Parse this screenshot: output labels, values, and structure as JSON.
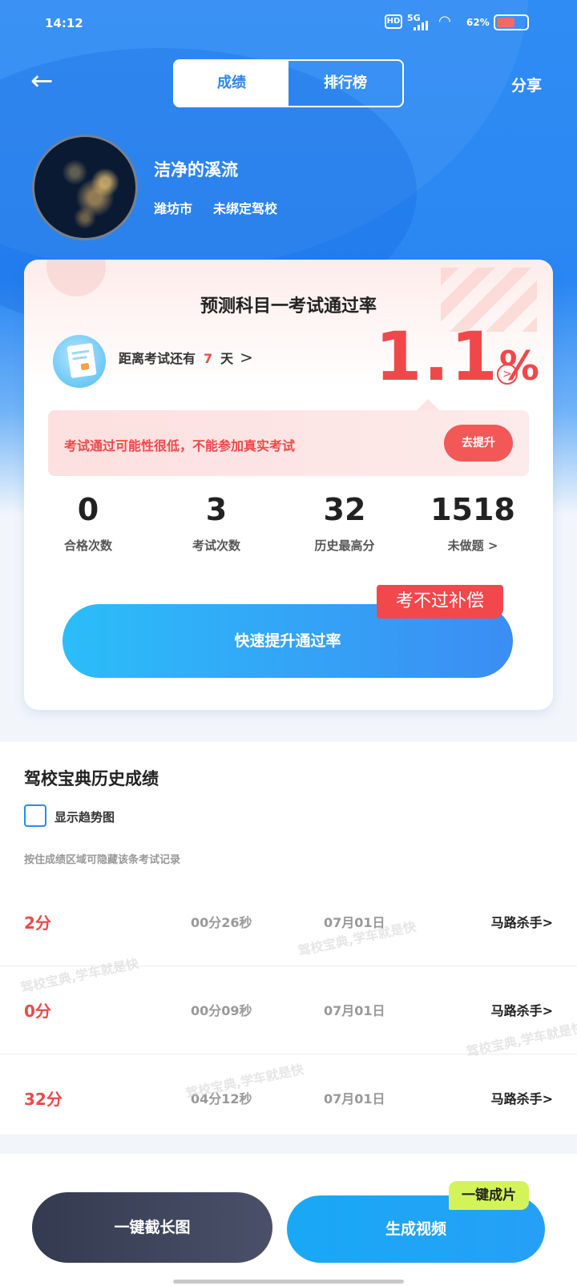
{
  "status_bar": {
    "time": "14:12",
    "hd": "HD",
    "network": "5G",
    "battery_pct": "62%",
    "battery_level": 0.62,
    "battery_color": "#f06a6a"
  },
  "header": {
    "back_icon": "arrow-left-icon",
    "tabs": [
      {
        "label": "成绩",
        "active": true
      },
      {
        "label": "排行榜",
        "active": false
      }
    ],
    "share_label": "分享"
  },
  "profile": {
    "name": "洁净的溪流",
    "city": "潍坊市",
    "school": "未绑定驾校"
  },
  "card": {
    "title": "预测科目一考试通过率",
    "countdown_prefix": "距离考试还有",
    "countdown_days": "7",
    "countdown_suffix": "天",
    "pass_rate_value": "1.1",
    "pass_rate_unit": "%",
    "warning_text": "考试通过可能性很低，不能参加真实考试",
    "warning_button": "去提升",
    "stats": [
      {
        "value": "0",
        "label": "合格次数"
      },
      {
        "value": "3",
        "label": "考试次数"
      },
      {
        "value": "32",
        "label": "历史最高分"
      },
      {
        "value": "1518",
        "label": "未做题"
      }
    ],
    "cta_label": "快速提升通过率",
    "compensation_badge": "考不过补偿"
  },
  "history": {
    "title": "驾校宝典历史成绩",
    "show_trend_label": "显示趋势图",
    "show_trend_checked": false,
    "hint": "按住成绩区域可隐藏该条考试记录",
    "records": [
      {
        "score": "2分",
        "duration": "00分26秒",
        "date": "07月01日",
        "tag": "马路杀手>"
      },
      {
        "score": "0分",
        "duration": "00分09秒",
        "date": "07月01日",
        "tag": "马路杀手>"
      },
      {
        "score": "32分",
        "duration": "04分12秒",
        "date": "07月01日",
        "tag": "马路杀手>"
      }
    ],
    "watermark": "驾校宝典,学车就是快"
  },
  "bottom_bar": {
    "screenshot_label": "一键截长图",
    "video_label": "生成视频",
    "oneclick_badge": "一键成片"
  },
  "colors": {
    "primary_blue": "#2f8cf4",
    "accent_red": "#f0484a",
    "badge_green": "#d4f35a"
  }
}
